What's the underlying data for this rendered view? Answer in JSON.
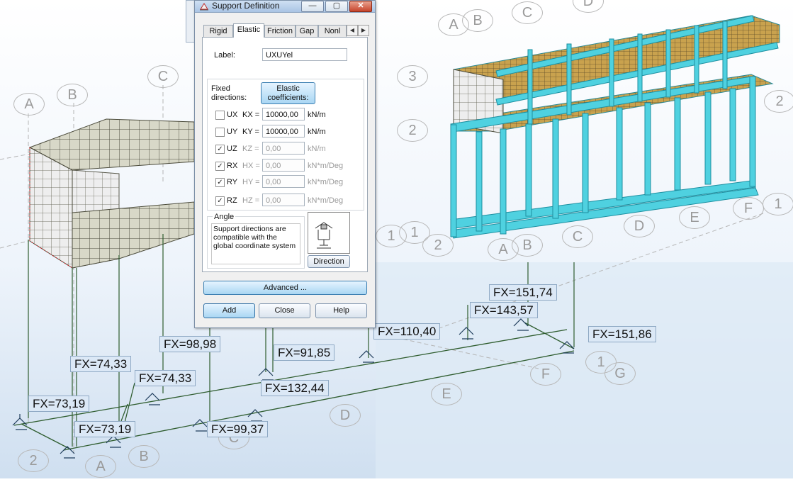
{
  "dialog": {
    "title": "Support Definition",
    "title_buttons": {
      "minimize": "—",
      "maximize": "▢",
      "close": "✕"
    },
    "tabs": [
      {
        "label": "Rigid"
      },
      {
        "label": "Elastic",
        "active": true
      },
      {
        "label": "Friction"
      },
      {
        "label": "Gap"
      },
      {
        "label": "Nonl"
      }
    ],
    "tab_scroll": {
      "left": "◀",
      "right": "▶"
    },
    "label_caption": "Label:",
    "label_value": "UXUYel",
    "fixed_directions_caption": "Fixed\ndirections:",
    "elastic_coefficients_button": "Elastic\ncoefficients:",
    "directions": [
      {
        "dir": "UX",
        "checked": false,
        "coef": "KX =",
        "value": "10000,00",
        "unit": "kN/m",
        "enabled": true
      },
      {
        "dir": "UY",
        "checked": false,
        "coef": "KY =",
        "value": "10000,00",
        "unit": "kN/m",
        "enabled": true
      },
      {
        "dir": "UZ",
        "checked": true,
        "coef": "KZ =",
        "value": "0,00",
        "unit": "kN/m",
        "enabled": false
      },
      {
        "dir": "RX",
        "checked": true,
        "coef": "HX =",
        "value": "0,00",
        "unit": "kN*m/Deg",
        "enabled": false
      },
      {
        "dir": "RY",
        "checked": true,
        "coef": "HY =",
        "value": "0,00",
        "unit": "kN*m/Deg",
        "enabled": false
      },
      {
        "dir": "RZ",
        "checked": true,
        "coef": "HZ =",
        "value": "0,00",
        "unit": "kN*m/Deg",
        "enabled": false
      }
    ],
    "angle_caption": "Angle",
    "angle_text": "Support directions are compatible with the global coordinate system",
    "direction_button": "Direction",
    "advanced_button": "Advanced ...",
    "add_button": "Add",
    "close_button": "Close",
    "help_button": "Help",
    "check_mark": "✓"
  },
  "fx_labels": [
    "FX=151,74",
    "FX=143,57",
    "FX=151,86",
    "FX=110,40",
    "FX=98,98",
    "FX=91,85",
    "FX=74,33",
    "FX=74,33",
    "FX=132,44",
    "FX=73,19",
    "FX=73,19",
    "FX=99,37"
  ],
  "axis_bubbles": [
    "A",
    "B",
    "C",
    "A",
    "B",
    "C",
    "D",
    "3",
    "2",
    "2",
    "1",
    "1",
    "2",
    "A",
    "B",
    "C",
    "D",
    "E",
    "F",
    "1",
    "F",
    "G",
    "1",
    "E",
    "D",
    "C",
    "2",
    "A",
    "B"
  ],
  "colors": {
    "steel": "#4fd1e0",
    "slab": "#c9a24e",
    "mesh": "#6f6f55",
    "ground": "#dde9f5"
  }
}
